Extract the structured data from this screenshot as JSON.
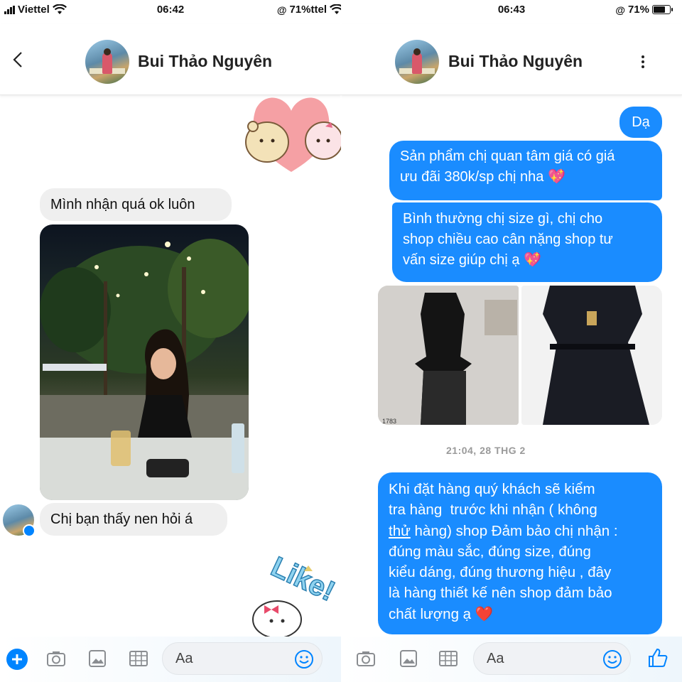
{
  "left": {
    "status": {
      "carrier": "Viettel",
      "time": "06:42",
      "battery": "71%ttel"
    },
    "header": {
      "name": "Bui Thảo Nguyên"
    },
    "messages": [
      {
        "text": "Mình nhận quá ok luôn"
      },
      {
        "text": "Chị bạn thấy nen hỏi á"
      }
    ],
    "sticker_text": "Like!",
    "composer": {
      "placeholder": "Aa"
    }
  },
  "right": {
    "status": {
      "time": "06:43",
      "battery": "71%"
    },
    "header": {
      "name": "Bui Thảo Nguyên"
    },
    "messages": [
      {
        "text": "Dạ"
      },
      {
        "line1": "Sản phẩm chị quan tâm giá có giá",
        "line2": "ưu đãi 380k/sp chị nha 💖"
      },
      {
        "line1": "Bình thường chị size gì, chị cho",
        "line2": "shop chiều cao cân nặng shop tư",
        "line3": "vấn size giúp chị ạ 💖"
      }
    ],
    "photo_caption": "1783",
    "timestamp": "21:04, 28 THG 2",
    "long_message": {
      "l1": "Khi đặt hàng quý khách sẽ kiểm",
      "l2": "tra hàng  trước khi nhận ( không",
      "l3a": "thử",
      "l3b": " hàng) shop Đảm bảo chị nhận :",
      "l4": "đúng màu sắc, đúng size, đúng",
      "l5": "kiểu dáng, đúng thương hiệu , đây",
      "l6": "là hàng thiết kế nên shop đảm bảo",
      "l7": "chất lượng ạ ❤️"
    },
    "composer": {
      "placeholder": "Aa"
    }
  },
  "colors": {
    "messenger_blue": "#1a8cff",
    "incoming_bubble": "#efefef",
    "icon_gray": "#8a8d91",
    "accent_blue": "#0084ff"
  }
}
